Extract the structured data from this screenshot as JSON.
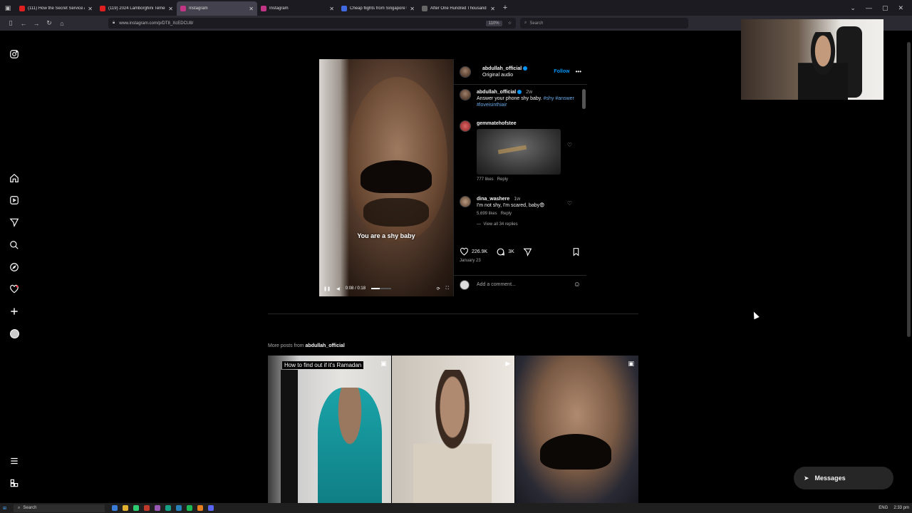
{
  "browser": {
    "tabs": [
      {
        "label": "(111) How the Secret Service A",
        "color": "#e02020",
        "active": false
      },
      {
        "label": "(119) 2024 Lamborghini Temer",
        "color": "#e02020",
        "active": false
      },
      {
        "label": "Instagram",
        "color": "#c13584",
        "active": true
      },
      {
        "label": "Instagram",
        "color": "#c13584",
        "active": false
      },
      {
        "label": "Cheap flights from Singapore t",
        "color": "#4169e1",
        "active": false
      },
      {
        "label": "After One Hundred Thousand I",
        "color": "#666666",
        "active": false
      }
    ],
    "url": "www.instagram.com/p/DT8_XcEDCU8/",
    "zoom": "110%",
    "search_placeholder": "Search"
  },
  "rail": {
    "icons": [
      "instagram-logo-icon",
      "home-icon",
      "reels-icon",
      "send-icon",
      "search-icon",
      "explore-icon",
      "heart-icon",
      "create-icon",
      "profile-icon",
      "menu-icon",
      "threads-icon"
    ]
  },
  "post": {
    "username": "abdullah_official",
    "subtitle": "Original audio",
    "follow_label": "Follow",
    "more_label": "•••",
    "video_caption": "You are a shy baby",
    "video_time": "0:08 / 0:18",
    "video_progress_fraction": 0.44,
    "caption": {
      "username": "abdullah_official",
      "time": "2w",
      "text": "Answer your phone shy baby.",
      "tags": "#shy #answer #loveisinthiair"
    },
    "comments": [
      {
        "username": "gemmatehofstee",
        "likes": "777 likes",
        "reply": "Reply",
        "has_gif": true
      },
      {
        "username": "dina_washere",
        "time": "1w",
        "text": "I'm not shy, I'm scared, baby😨",
        "likes": "5,699 likes",
        "reply": "Reply",
        "view_replies": "View all 34 replies"
      }
    ],
    "like_count": "226.9K",
    "comment_count": "3K",
    "date": "January 23",
    "add_comment_placeholder": "Add a comment..."
  },
  "more_posts": {
    "prefix": "More posts from",
    "username": "abdullah_official",
    "tiles": [
      {
        "label": "How to find out if it's Ramadan"
      },
      {
        "label": ""
      },
      {
        "label": ""
      }
    ]
  },
  "messages_label": "Messages",
  "taskbar": {
    "search_label": "Search",
    "language": "ENG",
    "time": "2:33 pm"
  }
}
